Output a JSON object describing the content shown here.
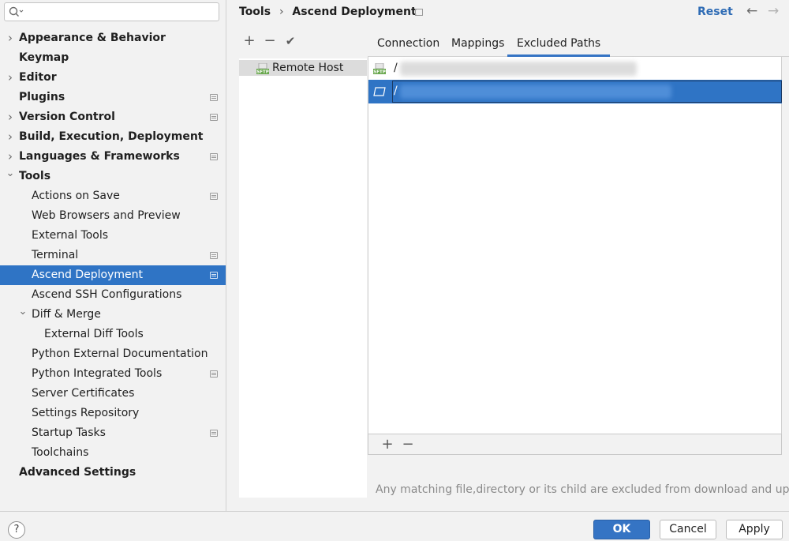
{
  "search": {
    "placeholder": ""
  },
  "sidebar": {
    "items": [
      {
        "label": "Appearance & Behavior",
        "indent": 0,
        "bold": true,
        "arrow": "right",
        "gear": false,
        "selected": false
      },
      {
        "label": "Keymap",
        "indent": 0,
        "bold": true,
        "arrow": "",
        "gear": false,
        "selected": false
      },
      {
        "label": "Editor",
        "indent": 0,
        "bold": true,
        "arrow": "right",
        "gear": false,
        "selected": false
      },
      {
        "label": "Plugins",
        "indent": 0,
        "bold": true,
        "arrow": "",
        "gear": true,
        "selected": false
      },
      {
        "label": "Version Control",
        "indent": 0,
        "bold": true,
        "arrow": "right",
        "gear": true,
        "selected": false
      },
      {
        "label": "Build, Execution, Deployment",
        "indent": 0,
        "bold": true,
        "arrow": "right",
        "gear": false,
        "selected": false
      },
      {
        "label": "Languages & Frameworks",
        "indent": 0,
        "bold": true,
        "arrow": "right",
        "gear": true,
        "selected": false
      },
      {
        "label": "Tools",
        "indent": 0,
        "bold": true,
        "arrow": "down",
        "gear": false,
        "selected": false
      },
      {
        "label": "Actions on Save",
        "indent": 1,
        "bold": false,
        "arrow": "",
        "gear": true,
        "selected": false
      },
      {
        "label": "Web Browsers and Preview",
        "indent": 1,
        "bold": false,
        "arrow": "",
        "gear": false,
        "selected": false
      },
      {
        "label": "External Tools",
        "indent": 1,
        "bold": false,
        "arrow": "",
        "gear": false,
        "selected": false
      },
      {
        "label": "Terminal",
        "indent": 1,
        "bold": false,
        "arrow": "",
        "gear": true,
        "selected": false
      },
      {
        "label": "Ascend Deployment",
        "indent": 1,
        "bold": false,
        "arrow": "",
        "gear": true,
        "selected": true
      },
      {
        "label": "Ascend SSH Configurations",
        "indent": 1,
        "bold": false,
        "arrow": "",
        "gear": false,
        "selected": false
      },
      {
        "label": "Diff & Merge",
        "indent": 1,
        "bold": false,
        "arrow": "down",
        "gear": false,
        "selected": false
      },
      {
        "label": "External Diff Tools",
        "indent": 2,
        "bold": false,
        "arrow": "",
        "gear": false,
        "selected": false
      },
      {
        "label": "Python External Documentation",
        "indent": 1,
        "bold": false,
        "arrow": "",
        "gear": false,
        "selected": false
      },
      {
        "label": "Python Integrated Tools",
        "indent": 1,
        "bold": false,
        "arrow": "",
        "gear": true,
        "selected": false
      },
      {
        "label": "Server Certificates",
        "indent": 1,
        "bold": false,
        "arrow": "",
        "gear": false,
        "selected": false
      },
      {
        "label": "Settings Repository",
        "indent": 1,
        "bold": false,
        "arrow": "",
        "gear": false,
        "selected": false
      },
      {
        "label": "Startup Tasks",
        "indent": 1,
        "bold": false,
        "arrow": "",
        "gear": true,
        "selected": false
      },
      {
        "label": "Toolchains",
        "indent": 1,
        "bold": false,
        "arrow": "",
        "gear": false,
        "selected": false
      },
      {
        "label": "Advanced Settings",
        "indent": 0,
        "bold": true,
        "arrow": "",
        "gear": false,
        "selected": false
      }
    ]
  },
  "header": {
    "breadcrumb_parent": "Tools",
    "breadcrumb_sep": "›",
    "breadcrumb_current": "Ascend Deployment",
    "reset": "Reset",
    "back": "←",
    "forward": "→"
  },
  "hosts": {
    "toolbar": {
      "add": "+",
      "remove": "−",
      "apply": "✔"
    },
    "items": [
      {
        "label": "Remote Host"
      }
    ]
  },
  "tabs": [
    {
      "label": "Connection",
      "active": false
    },
    {
      "label": "Mappings",
      "active": false
    },
    {
      "label": "Excluded Paths",
      "active": true
    }
  ],
  "excluded_paths": {
    "rows": [
      {
        "prefix": "/",
        "selected": false
      },
      {
        "prefix": "/",
        "selected": true
      }
    ],
    "toolbar": {
      "add": "+",
      "remove": "−"
    },
    "hint": "Any matching file,directory or its child are excluded from download and upload"
  },
  "footer": {
    "help": "?",
    "ok": "OK",
    "cancel": "Cancel",
    "apply": "Apply"
  },
  "colors": {
    "selection": "#2f74c5",
    "link": "#2f6cb5",
    "sftp_green": "#6aa84f"
  }
}
